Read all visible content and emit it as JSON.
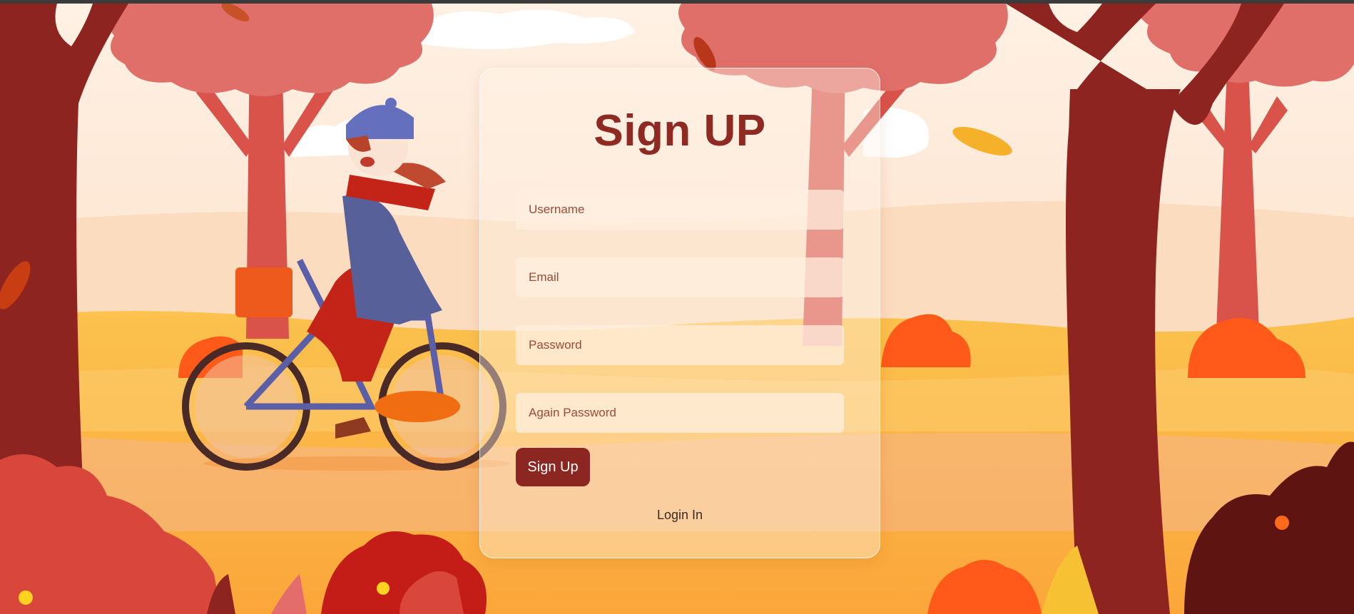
{
  "form": {
    "title": "Sign UP",
    "username_placeholder": "Username",
    "email_placeholder": "Email",
    "password_placeholder": "Password",
    "again_password_placeholder": "Again Password",
    "submit_label": "Sign Up",
    "login_link": "Login In"
  },
  "colors": {
    "accent": "#8c2620",
    "title": "#8f2a22",
    "sky": "#fdeee0",
    "ground": "#fbb34a",
    "tree_trunk": "#8e241f",
    "foliage": "#e06f6a"
  }
}
